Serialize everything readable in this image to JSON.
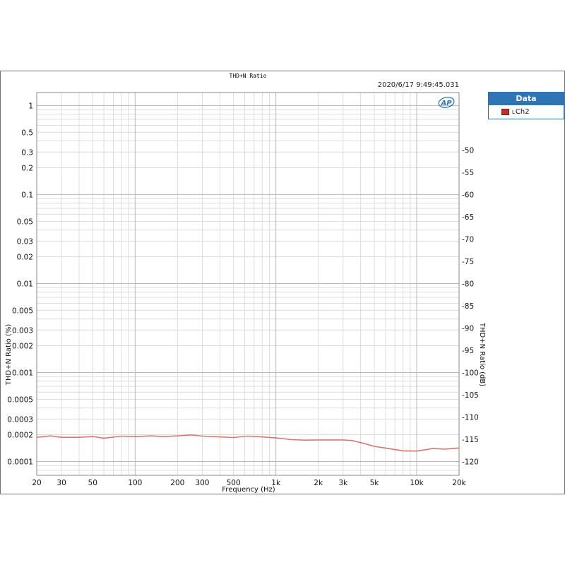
{
  "chart_data": {
    "type": "line",
    "title": "THD+N Ratio",
    "timestamp": "2020/6/17 9:49:45.031",
    "logo_text": "AP",
    "xlabel": "Frequency (Hz)",
    "ylabel_left": "THD+N Ratio (%)",
    "ylabel_right": "THD+N Ratio (dB)",
    "x_scale": "log",
    "y_scale": "log",
    "xlim": [
      20,
      20000
    ],
    "ylim_left": [
      7e-05,
      1.4
    ],
    "ylim_right": [
      -123.1,
      -37.1
    ],
    "grid": true,
    "legend_placement": "outside-right",
    "x_ticks": [
      {
        "value": 20,
        "label": "20"
      },
      {
        "value": 30,
        "label": "30"
      },
      {
        "value": 50,
        "label": "50"
      },
      {
        "value": 100,
        "label": "100"
      },
      {
        "value": 200,
        "label": "200"
      },
      {
        "value": 300,
        "label": "300"
      },
      {
        "value": 500,
        "label": "500"
      },
      {
        "value": 1000,
        "label": "1k"
      },
      {
        "value": 2000,
        "label": "2k"
      },
      {
        "value": 3000,
        "label": "3k"
      },
      {
        "value": 5000,
        "label": "5k"
      },
      {
        "value": 10000,
        "label": "10k"
      },
      {
        "value": 20000,
        "label": "20k"
      }
    ],
    "y_ticks_left": [
      {
        "value": 1,
        "label": "1"
      },
      {
        "value": 0.5,
        "label": "0.5"
      },
      {
        "value": 0.3,
        "label": "0.3"
      },
      {
        "value": 0.2,
        "label": "0.2"
      },
      {
        "value": 0.1,
        "label": "0.1"
      },
      {
        "value": 0.05,
        "label": "0.05"
      },
      {
        "value": 0.03,
        "label": "0.03"
      },
      {
        "value": 0.02,
        "label": "0.02"
      },
      {
        "value": 0.01,
        "label": "0.01"
      },
      {
        "value": 0.005,
        "label": "0.005"
      },
      {
        "value": 0.003,
        "label": "0.003"
      },
      {
        "value": 0.002,
        "label": "0.002"
      },
      {
        "value": 0.001,
        "label": "0.001"
      },
      {
        "value": 0.0005,
        "label": "0.0005"
      },
      {
        "value": 0.0003,
        "label": "0.0003"
      },
      {
        "value": 0.0002,
        "label": "0.0002"
      },
      {
        "value": 0.0001,
        "label": "0.0001"
      }
    ],
    "y_ticks_right": [
      {
        "value": -50,
        "label": "-50"
      },
      {
        "value": -55,
        "label": "-55"
      },
      {
        "value": -60,
        "label": "-60"
      },
      {
        "value": -65,
        "label": "-65"
      },
      {
        "value": -70,
        "label": "-70"
      },
      {
        "value": -75,
        "label": "-75"
      },
      {
        "value": -80,
        "label": "-80"
      },
      {
        "value": -85,
        "label": "-85"
      },
      {
        "value": -90,
        "label": "-90"
      },
      {
        "value": -95,
        "label": "-95"
      },
      {
        "value": -100,
        "label": "-100"
      },
      {
        "value": -105,
        "label": "-105"
      },
      {
        "value": -110,
        "label": "-110"
      },
      {
        "value": -115,
        "label": "-115"
      },
      {
        "value": -120,
        "label": "-120"
      }
    ],
    "legend_title": "Data",
    "series": [
      {
        "name": "Ch2",
        "name_prefix": "L",
        "color": "#d9776f",
        "x": [
          20,
          25,
          30,
          40,
          50,
          60,
          80,
          100,
          130,
          160,
          200,
          250,
          300,
          400,
          500,
          630,
          800,
          1000,
          1300,
          1600,
          2000,
          2500,
          3000,
          3500,
          4000,
          5000,
          6300,
          8000,
          10000,
          13000,
          16000,
          20000
        ],
        "values": [
          0.000187,
          0.000194,
          0.000187,
          0.000187,
          0.000191,
          0.000183,
          0.000193,
          0.000191,
          0.000194,
          0.000191,
          0.000194,
          0.000199,
          0.000193,
          0.000189,
          0.000186,
          0.000193,
          0.000189,
          0.000184,
          0.000176,
          0.000174,
          0.000175,
          0.000175,
          0.000175,
          0.000172,
          0.000163,
          0.000148,
          0.00014,
          0.000132,
          0.000131,
          0.00014,
          0.000138,
          0.000142
        ]
      }
    ]
  }
}
